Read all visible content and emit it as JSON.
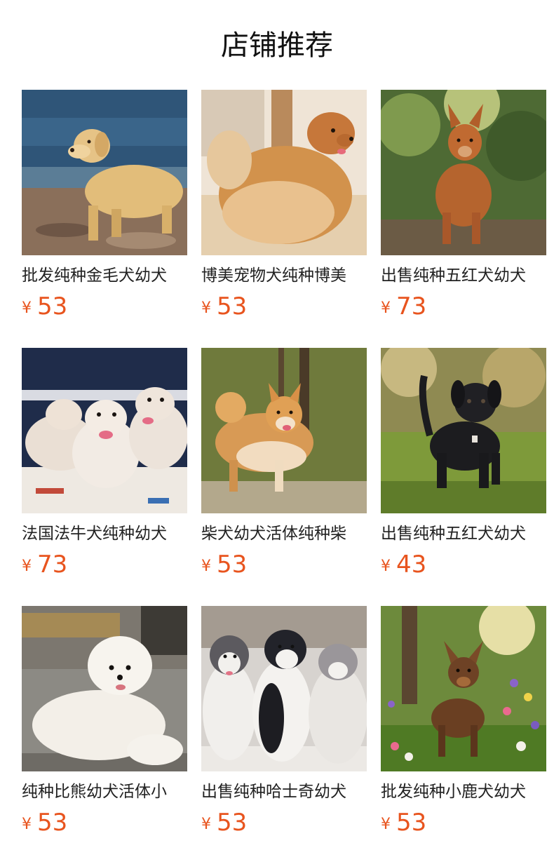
{
  "section": {
    "title": "店铺推荐"
  },
  "products": [
    {
      "name": "批发纯种金毛犬幼犬",
      "currency": "¥",
      "price": "53",
      "image": "golden-retriever-photo"
    },
    {
      "name": "博美宠物犬纯种博美",
      "currency": "¥",
      "price": "53",
      "image": "pomeranian-photo"
    },
    {
      "name": "出售纯种五红犬幼犬",
      "currency": "¥",
      "price": "73",
      "image": "red-dog-forest-photo"
    },
    {
      "name": "法国法牛犬纯种幼犬",
      "currency": "¥",
      "price": "73",
      "image": "french-bulldog-puppies-photo"
    },
    {
      "name": "柴犬幼犬活体纯种柴",
      "currency": "¥",
      "price": "53",
      "image": "shiba-inu-photo"
    },
    {
      "name": "出售纯种五红犬幼犬",
      "currency": "¥",
      "price": "43",
      "image": "black-puppy-grass-photo"
    },
    {
      "name": "纯种比熊幼犬活体小",
      "currency": "¥",
      "price": "53",
      "image": "bichon-frise-photo"
    },
    {
      "name": "出售纯种哈士奇幼犬",
      "currency": "¥",
      "price": "53",
      "image": "husky-puppies-photo"
    },
    {
      "name": "批发纯种小鹿犬幼犬",
      "currency": "¥",
      "price": "53",
      "image": "miniature-pinscher-flowers-photo"
    }
  ],
  "colors": {
    "price": "#e8541e",
    "title": "#111111",
    "name": "#222222"
  }
}
